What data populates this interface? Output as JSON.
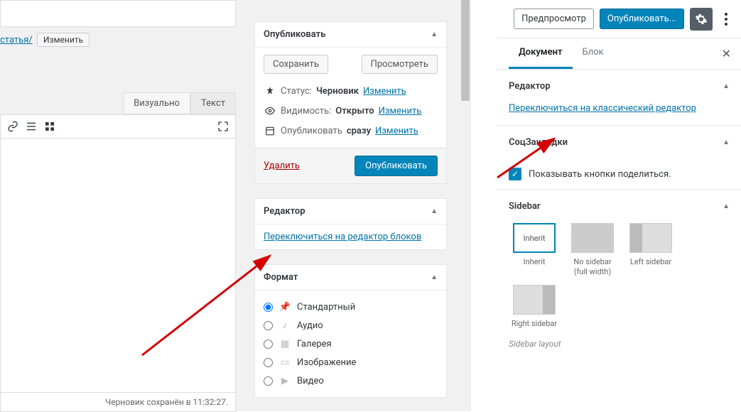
{
  "left": {
    "permalink_slug": "статья/",
    "edit_slug": "Изменить",
    "tabs": {
      "visual": "Визуально",
      "text": "Текст"
    },
    "status_bar": "Черновик сохранён в 11:32:27."
  },
  "publish_box": {
    "title": "Опубликовать",
    "save": "Сохранить",
    "preview": "Просмотреть",
    "status_label": "Статус:",
    "status_value": "Черновик",
    "visibility_label": "Видимость:",
    "visibility_value": "Открыто",
    "schedule_label": "Опубликовать",
    "schedule_value": "сразу",
    "edit": "Изменить",
    "delete": "Удалить",
    "publish": "Опубликовать"
  },
  "editor_box": {
    "title": "Редактор",
    "switch_link": "Переключиться на редактор блоков"
  },
  "format_box": {
    "title": "Формат",
    "items": [
      "Стандартный",
      "Аудио",
      "Галерея",
      "Изображение",
      "Видео"
    ]
  },
  "right": {
    "preview": "Предпросмотр",
    "publish": "Опубликовать...",
    "tabs": {
      "document": "Документ",
      "block": "Блок"
    },
    "editor_panel": {
      "title": "Редактор",
      "switch": "Переключиться на классический редактор"
    },
    "social_panel": {
      "title": "СоцЗакладки",
      "checkbox": "Показывать кнопки поделиться."
    },
    "sidebar_panel": {
      "title": "Sidebar",
      "options": [
        {
          "box_text": "Inherit",
          "label": "Inherit"
        },
        {
          "box_text": "",
          "label": "No sidebar (full width)"
        },
        {
          "box_text": "",
          "label": "Left sidebar"
        },
        {
          "box_text": "",
          "label": "Right sidebar"
        }
      ],
      "caption": "Sidebar layout"
    }
  }
}
